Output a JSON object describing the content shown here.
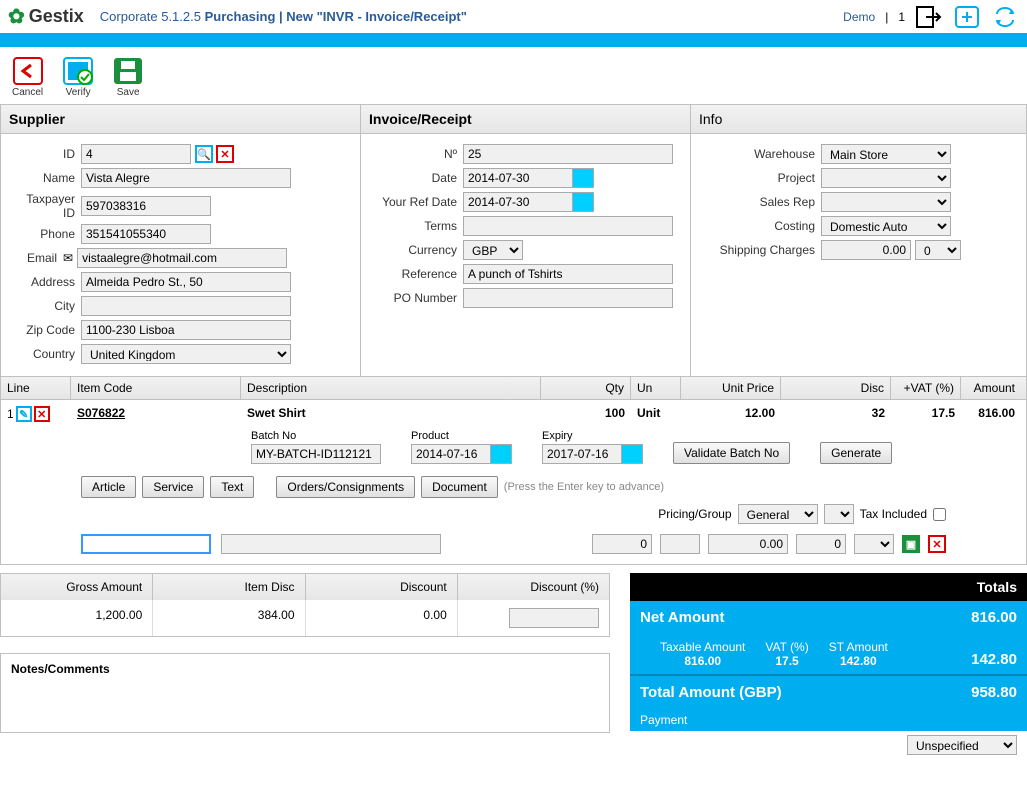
{
  "header": {
    "brand": "Gestix",
    "version": "Corporate 5.1.2.5",
    "module": "Purchasing",
    "page": "New \"INVR - Invoice/Receipt\"",
    "demo": "Demo",
    "pipe_num": "1"
  },
  "toolbar": {
    "cancel": "Cancel",
    "verify": "Verify",
    "save": "Save"
  },
  "supplier": {
    "title": "Supplier",
    "labels": {
      "id": "ID",
      "name": "Name",
      "taxpayer": "Taxpayer ID",
      "phone": "Phone",
      "email": "Email",
      "address": "Address",
      "city": "City",
      "zip": "Zip Code",
      "country": "Country"
    },
    "id": "4",
    "name": "Vista Alegre",
    "taxpayer": "597038316",
    "phone": "351541055340",
    "email": "vistaalegre@hotmail.com",
    "address": "Almeida Pedro St., 50",
    "city": "",
    "zip": "1100-230 Lisboa",
    "country": "United Kingdom"
  },
  "invoice": {
    "title": "Invoice/Receipt",
    "labels": {
      "num": "Nº",
      "date": "Date",
      "yourref": "Your Ref Date",
      "terms": "Terms",
      "currency": "Currency",
      "reference": "Reference",
      "po": "PO Number"
    },
    "num": "25",
    "date": "2014-07-30",
    "yourref": "2014-07-30",
    "terms": "",
    "currency": "GBP",
    "reference": "A punch of Tshirts",
    "po": ""
  },
  "info": {
    "title": "Info",
    "labels": {
      "warehouse": "Warehouse",
      "project": "Project",
      "salesrep": "Sales Rep",
      "costing": "Costing",
      "shipping": "Shipping Charges"
    },
    "warehouse": "Main Store",
    "project": "",
    "salesrep": "",
    "costing": "Domestic Auto",
    "shipping_amount": "0.00",
    "shipping_qty": "0"
  },
  "grid": {
    "headers": {
      "line": "Line",
      "code": "Item Code",
      "desc": "Description",
      "qty": "Qty",
      "un": "Un",
      "price": "Unit Price",
      "disc": "Disc",
      "vat": "+VAT (%)",
      "amount": "Amount"
    },
    "row": {
      "num": "1",
      "code": "S076822",
      "desc": "Swet Shirt",
      "qty": "100",
      "un": "Unit",
      "price": "12.00",
      "disc": "32",
      "vat": "17.5",
      "amount": "816.00"
    },
    "batch": {
      "labels": {
        "batch": "Batch No",
        "product": "Product",
        "expiry": "Expiry"
      },
      "batch": "MY-BATCH-ID112121",
      "product": "2014-07-16",
      "expiry": "2017-07-16",
      "validate": "Validate Batch No",
      "generate": "Generate"
    },
    "buttons": {
      "article": "Article",
      "service": "Service",
      "text": "Text",
      "orders": "Orders/Consignments",
      "document": "Document"
    },
    "hint": "(Press the Enter key to advance)",
    "pricing_label": "Pricing/Group",
    "pricing": "General",
    "tax_incl": "Tax Included",
    "entry": {
      "qty": "0",
      "price": "0.00",
      "disc": "0"
    }
  },
  "summary": {
    "headers": {
      "gross": "Gross Amount",
      "itemdisc": "Item Disc",
      "discount": "Discount",
      "discountpct": "Discount (%)"
    },
    "gross": "1,200.00",
    "itemdisc": "384.00",
    "discount": "0.00",
    "discountpct": ""
  },
  "notes_label": "Notes/Comments",
  "totals": {
    "title": "Totals",
    "net_label": "Net Amount",
    "net": "816.00",
    "tax": {
      "taxable": "Taxable Amount",
      "vat": "VAT (%)",
      "st": "ST Amount",
      "taxable_v": "816.00",
      "vat_v": "17.5",
      "st_v": "142.80",
      "sum": "142.80"
    },
    "total_label": "Total Amount (GBP)",
    "total": "958.80",
    "payment_label": "Payment",
    "payment": "Unspecified"
  }
}
